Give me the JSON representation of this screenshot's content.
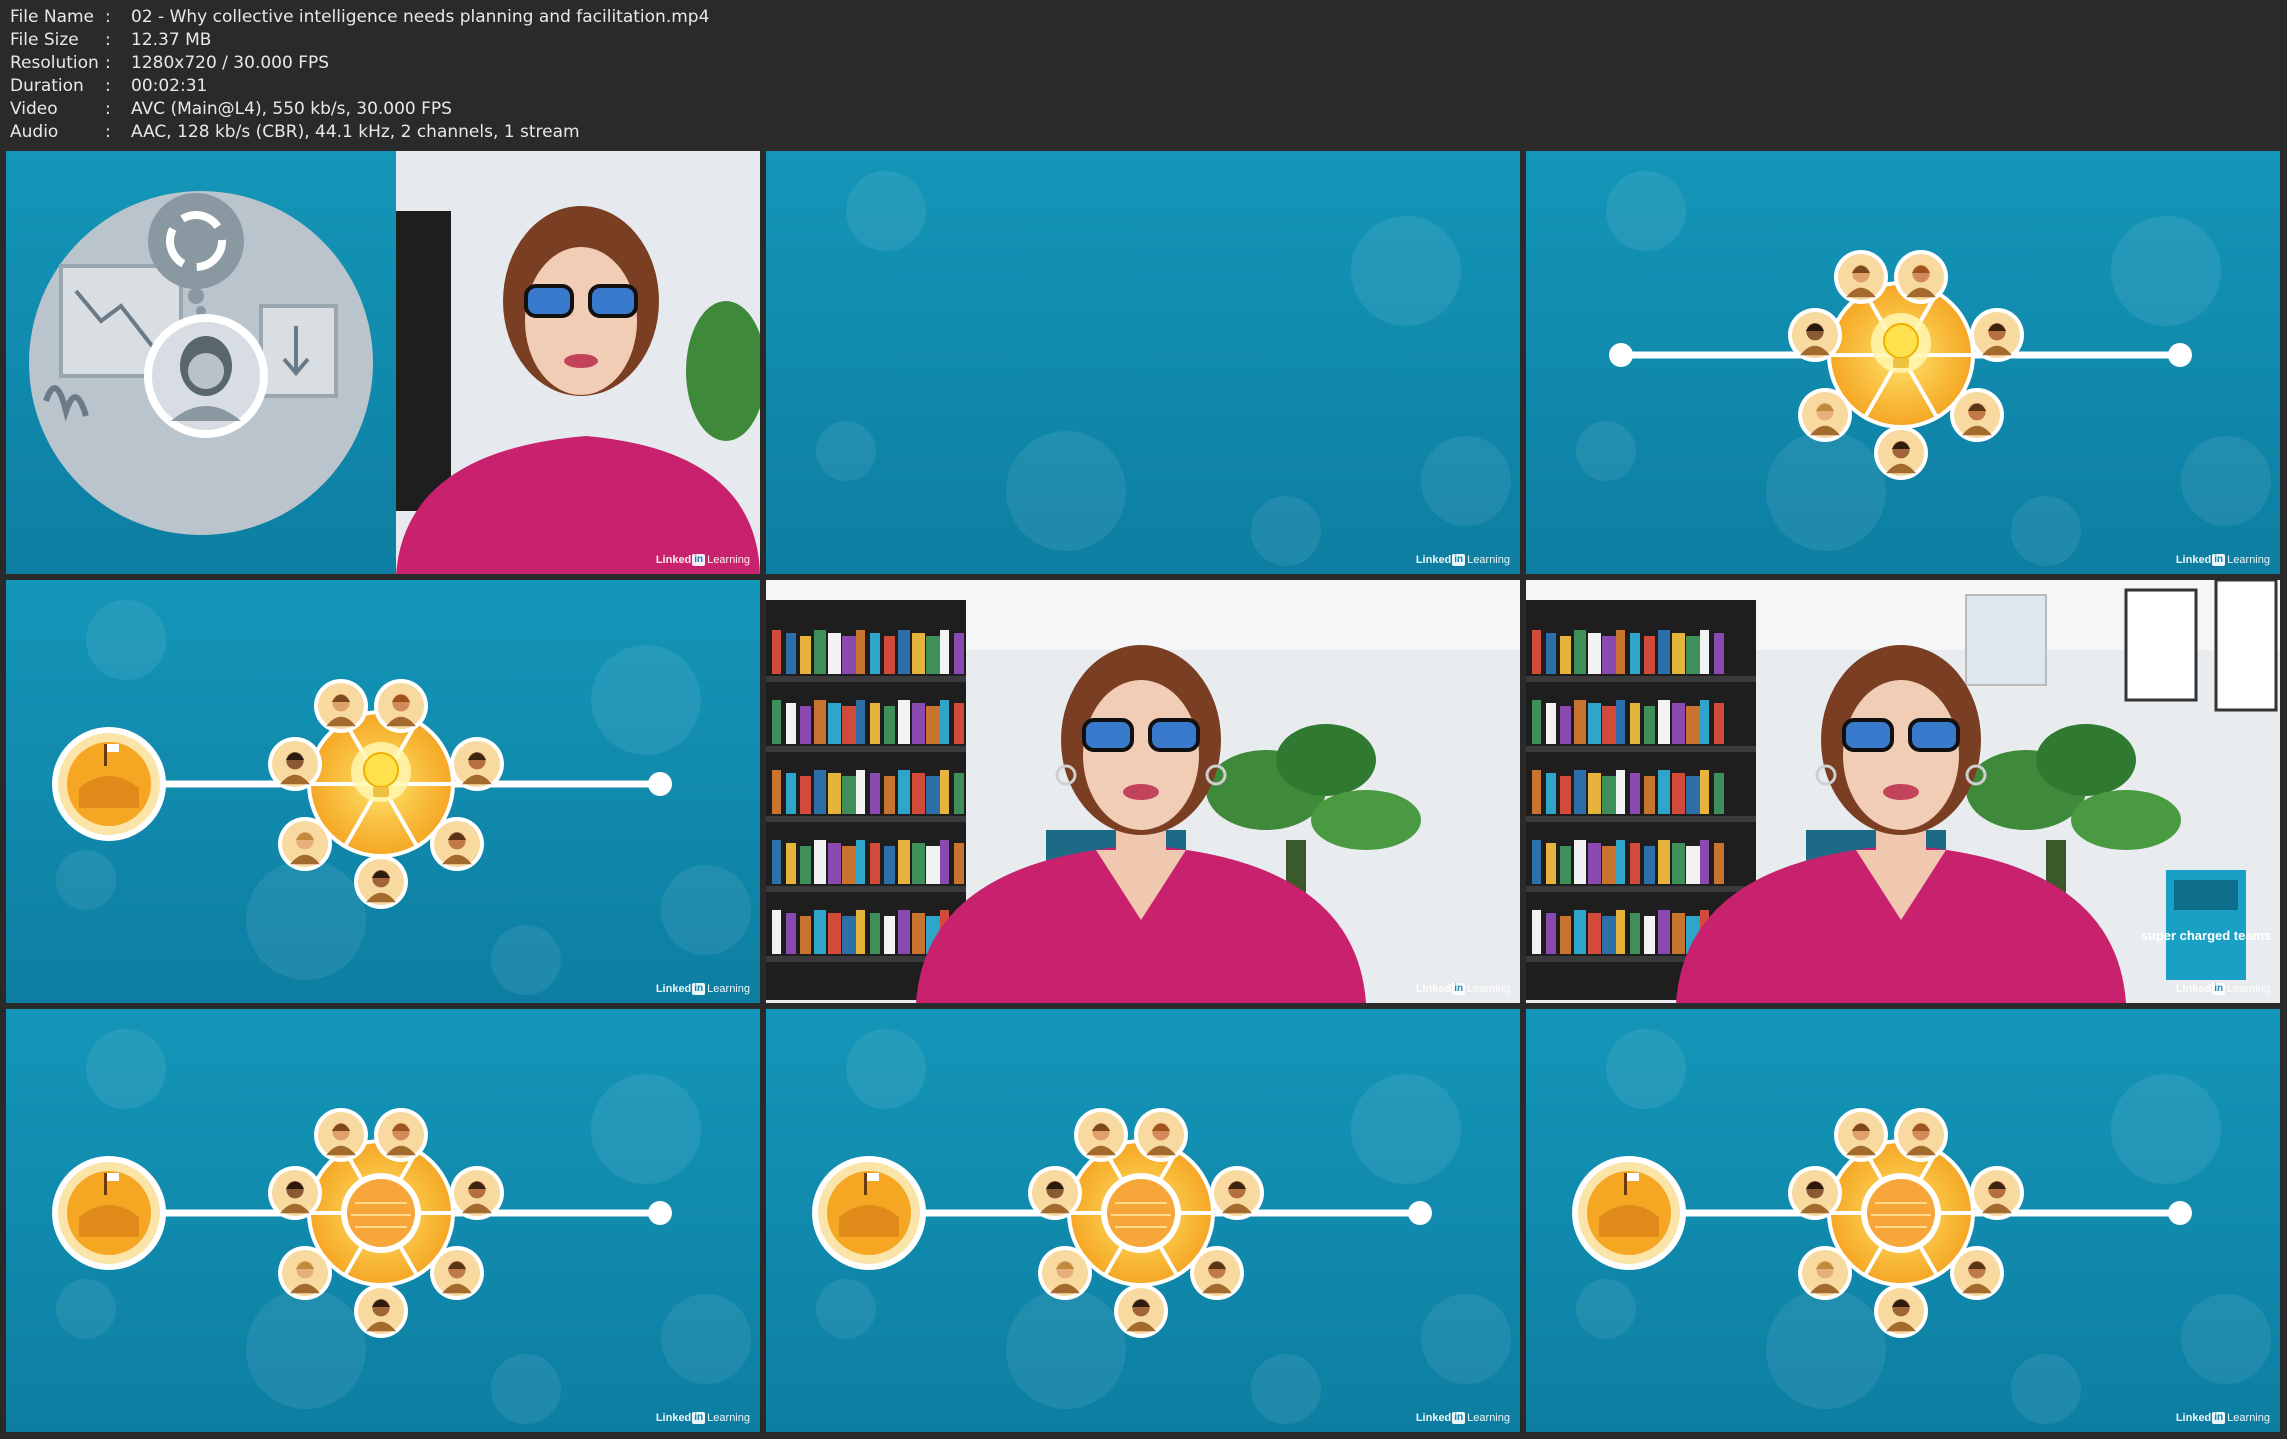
{
  "file_info": [
    {
      "key": "File Name",
      "value": "02 - Why collective intelligence needs planning and facilitation.mp4"
    },
    {
      "key": "File Size",
      "value": "12.37 MB"
    },
    {
      "key": "Resolution",
      "value": "1280x720 / 30.000 FPS"
    },
    {
      "key": "Duration",
      "value": "00:02:31"
    },
    {
      "key": "Video",
      "value": "AVC (Main@L4), 550 kb/s, 30.000 FPS"
    },
    {
      "key": "Audio",
      "value": "AAC, 128 kb/s (CBR), 44.1 kHz, 2 channels, 1 stream"
    }
  ],
  "separator": ":",
  "watermark": {
    "pre": "Linked",
    "box": "in",
    "post": "Learning"
  },
  "book_title": "super charged teams",
  "colors": {
    "teal": "#1496b8",
    "honey": "#f5a623",
    "pink": "#c8226f"
  },
  "frames": [
    {
      "type": "presenter-with-illustration",
      "icons": [
        "refresh-icon",
        "person-avatar-icon"
      ]
    },
    {
      "type": "blank-teal"
    },
    {
      "type": "hive-timeline",
      "start_node": false,
      "highlight": "bulb"
    },
    {
      "type": "hive-timeline",
      "start_node": true,
      "highlight": "bulb"
    },
    {
      "type": "presenter-office"
    },
    {
      "type": "presenter-office"
    },
    {
      "type": "hive-timeline",
      "start_node": true,
      "highlight": "honeycomb"
    },
    {
      "type": "hive-timeline",
      "start_node": true,
      "highlight": "honeycomb"
    },
    {
      "type": "hive-timeline",
      "start_node": true,
      "highlight": "honeycomb"
    }
  ]
}
